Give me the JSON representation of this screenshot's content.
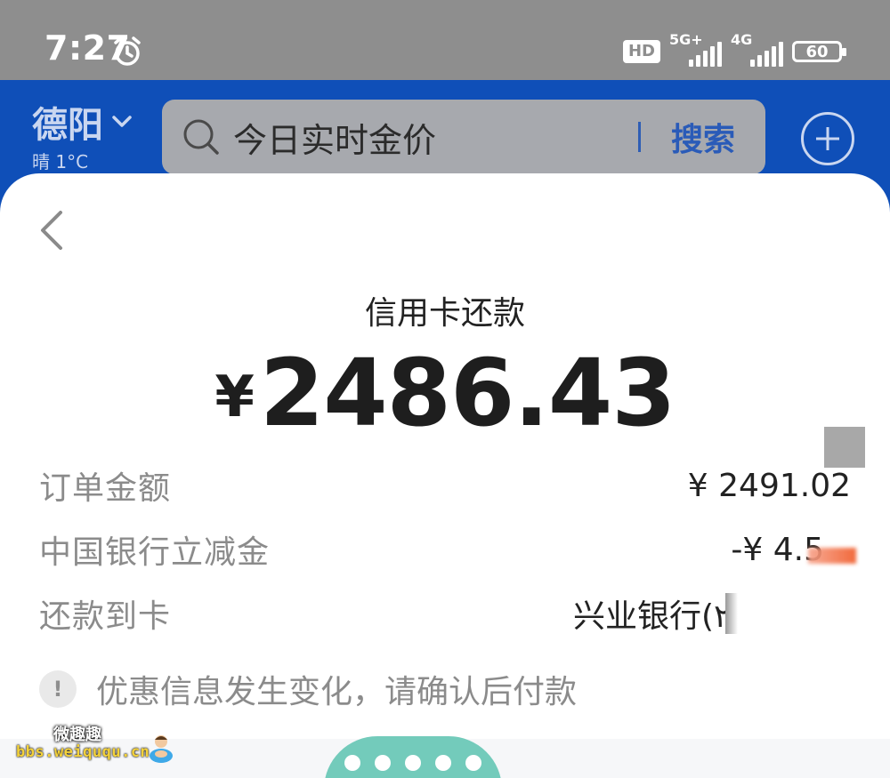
{
  "status_bar": {
    "time": "7:27",
    "hd_badge": "HD",
    "network_1": "5G+",
    "network_2": "4G",
    "battery": "60"
  },
  "header": {
    "city": "德阳",
    "weather": "晴 1°C",
    "search_placeholder": "今日实时金价",
    "search_button": "搜索"
  },
  "payment": {
    "title": "信用卡还款",
    "currency": "¥",
    "amount": "2486.43",
    "rows": {
      "order_label": "订单金额",
      "order_value": "¥ 2491.02",
      "discount_label": "中国银行立减金",
      "discount_value": "-¥ 4.5",
      "card_label": "还款到卡",
      "card_value": "兴业银行(۲"
    },
    "notice": "优惠信息发生变化，请确认后付款",
    "notice_icon": "!"
  },
  "watermark": {
    "top": "微趣趣",
    "url": "bbs.weiququ.cn"
  },
  "colors": {
    "header_blue": "#0F4FB8",
    "status_gray": "#8E8E8E",
    "discount_orange": "#F05A28",
    "bubble_teal": "#73CBBB"
  },
  "icons": [
    "alarm-icon",
    "search-icon",
    "chevron-down-icon",
    "plus-icon",
    "back-chevron-icon",
    "info-icon"
  ]
}
